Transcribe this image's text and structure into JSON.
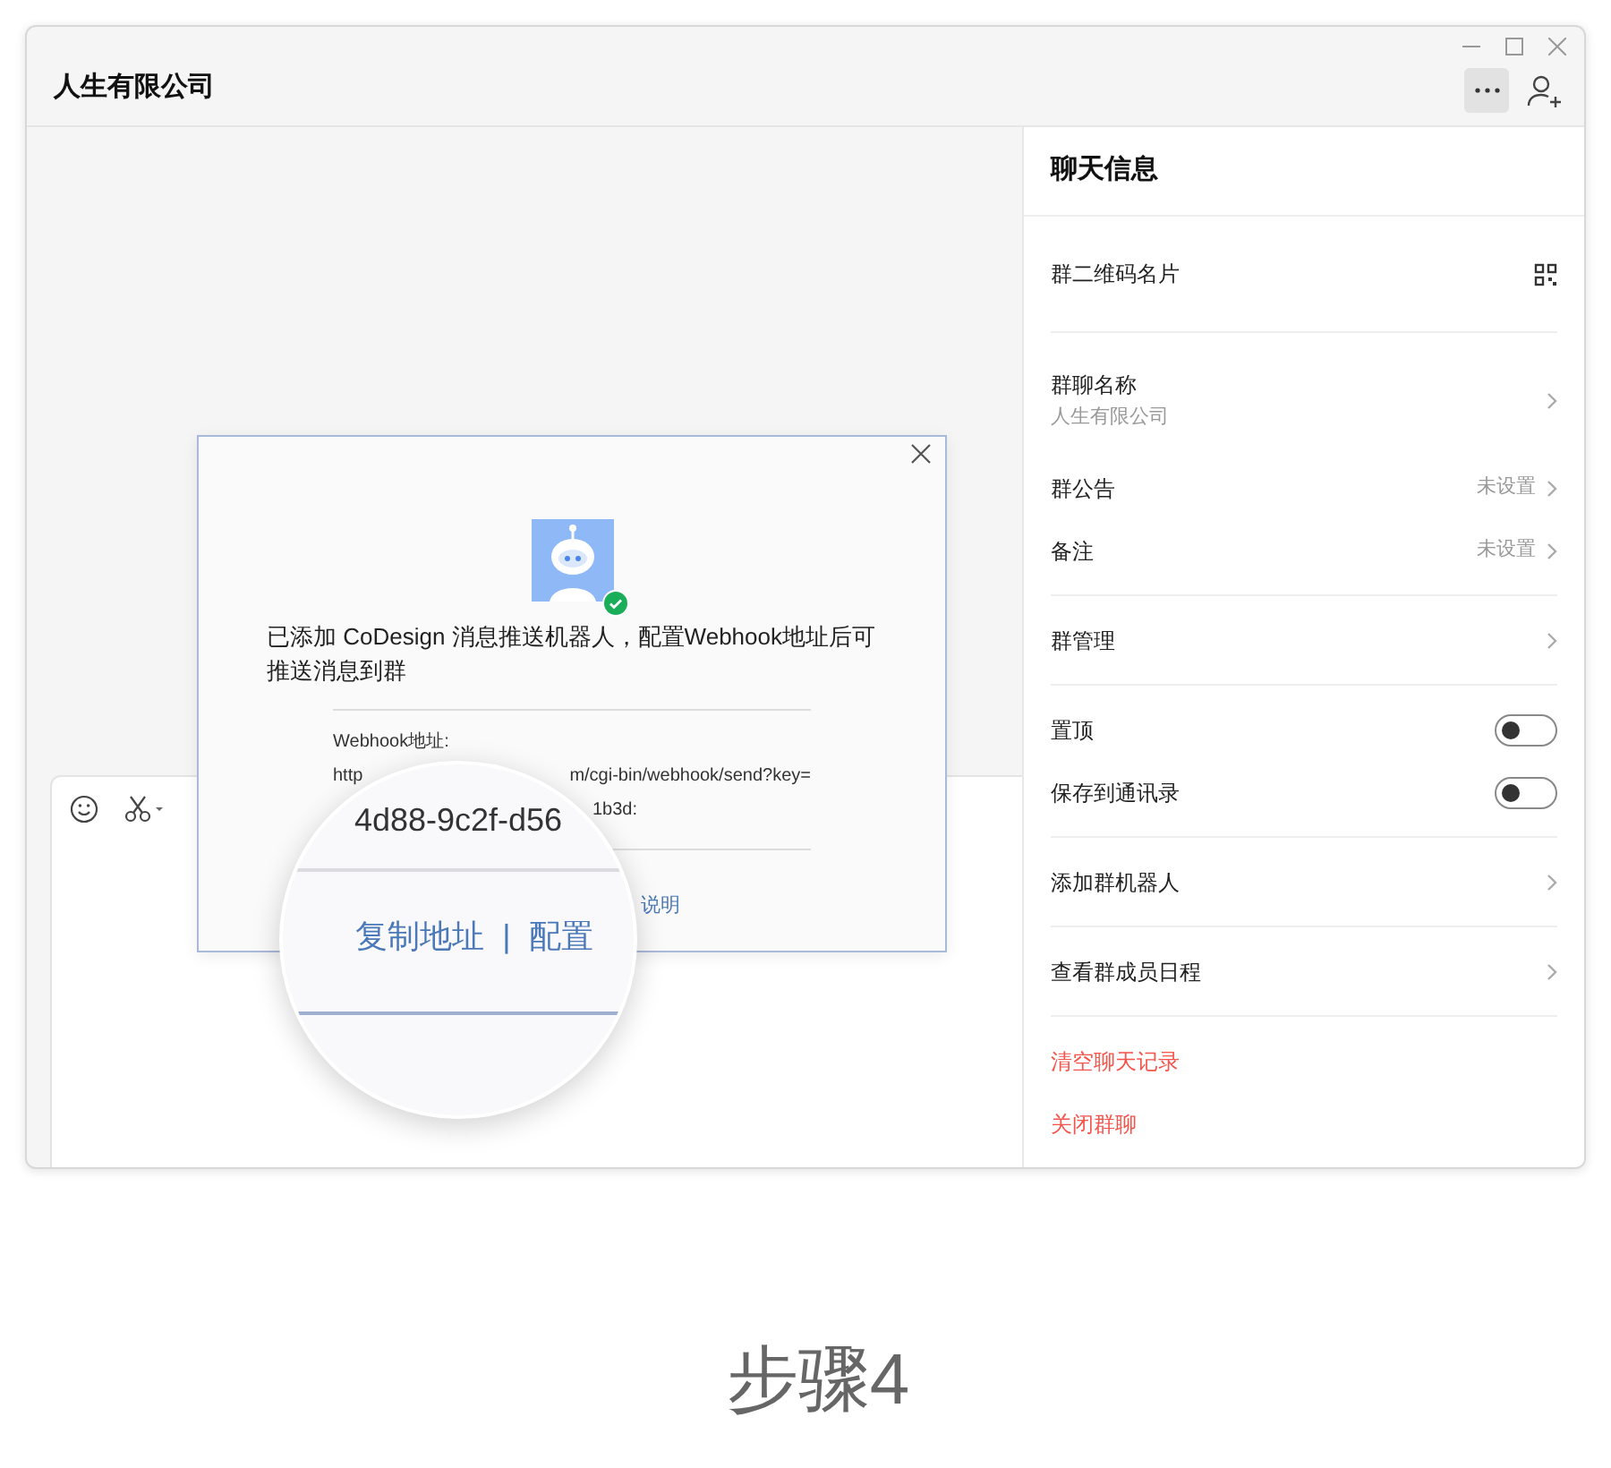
{
  "window": {
    "title": "人生有限公司"
  },
  "dialog": {
    "message": "已添加 CoDesign 消息推送机器人，配置Webhook地址后可推送消息到群",
    "webhook_label": "Webhook地址:",
    "url_start": "http",
    "url_end": "m/cgi-bin/webhook/send?key=",
    "url_line2": "1b3d:",
    "link": "说明"
  },
  "magnifier": {
    "key_text": "4d88-9c2f-d56",
    "copy": "复制地址",
    "separator": "|",
    "configure": "配置"
  },
  "panel": {
    "title": "聊天信息",
    "sections": [
      [
        {
          "kind": "qr",
          "label": "群二维码名片"
        }
      ],
      [
        {
          "kind": "nav",
          "label": "群聊名称",
          "subtitle": "人生有限公司"
        },
        {
          "kind": "nav",
          "label": "群公告",
          "value": "未设置"
        },
        {
          "kind": "nav",
          "label": "备注",
          "value": "未设置"
        }
      ],
      [
        {
          "kind": "nav",
          "label": "群管理"
        }
      ],
      [
        {
          "kind": "toggle",
          "label": "置顶",
          "on": false
        },
        {
          "kind": "toggle",
          "label": "保存到通讯录",
          "on": false
        }
      ],
      [
        {
          "kind": "nav",
          "label": "添加群机器人"
        }
      ],
      [
        {
          "kind": "nav",
          "label": "查看群成员日程"
        }
      ],
      [
        {
          "kind": "danger",
          "label": "清空聊天记录"
        },
        {
          "kind": "danger",
          "label": "关闭群聊"
        }
      ]
    ]
  },
  "caption": "步骤4"
}
